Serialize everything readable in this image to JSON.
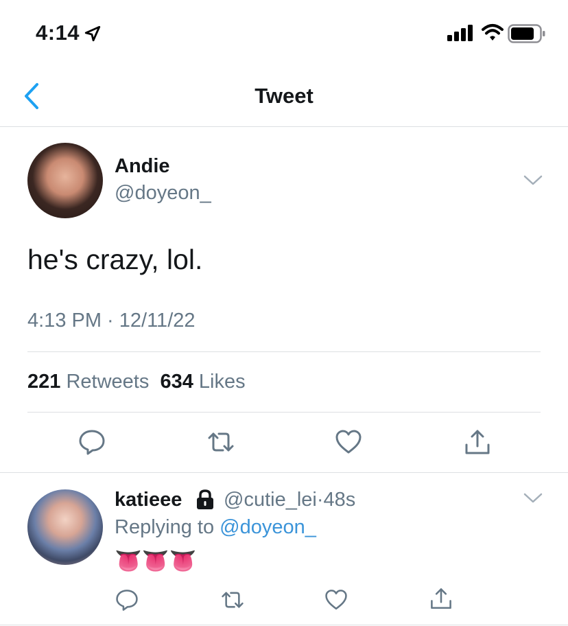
{
  "status_bar": {
    "time": "4:14"
  },
  "nav": {
    "title": "Tweet"
  },
  "tweet": {
    "author_name": "Andie",
    "author_handle": "@doyeon_",
    "text": "he's crazy, lol.",
    "timestamp": "4:13 PM · 12/11/22",
    "retweets_count": "221",
    "retweets_label": "Retweets",
    "likes_count": "634",
    "likes_label": "Likes"
  },
  "reply": {
    "author_name": "katieee",
    "author_handle": "@cutie_lei",
    "separator": "·",
    "age": "48s",
    "replying_to_label": "Replying to",
    "replying_to_handle": "@doyeon_",
    "emoji": "👅👅👅"
  },
  "colors": {
    "accent": "#1da1f2",
    "secondary_text": "#657786",
    "divider": "#dcdfe2"
  }
}
